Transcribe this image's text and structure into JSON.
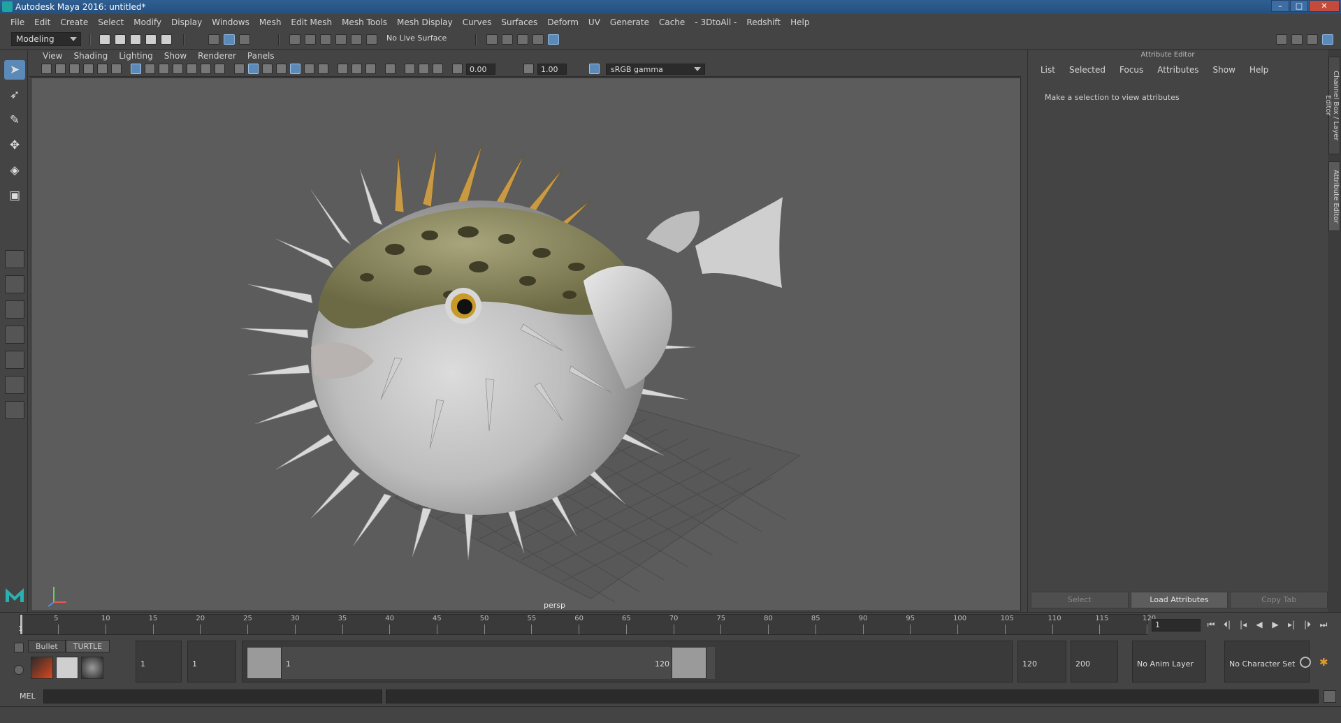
{
  "window": {
    "title": "Autodesk Maya 2016: untitled*",
    "buttons": [
      "–",
      "□",
      "✕"
    ]
  },
  "menubar": [
    "File",
    "Edit",
    "Create",
    "Select",
    "Modify",
    "Display",
    "Windows",
    "Mesh",
    "Edit Mesh",
    "Mesh Tools",
    "Mesh Display",
    "Curves",
    "Surfaces",
    "Deform",
    "UV",
    "Generate",
    "Cache",
    "- 3DtoAll -",
    "Redshift",
    "Help"
  ],
  "statusline": {
    "mode": "Modeling",
    "live_surface": "No Live Surface"
  },
  "viewport": {
    "menus": [
      "View",
      "Shading",
      "Lighting",
      "Show",
      "Renderer",
      "Panels"
    ],
    "exposure": "0.00",
    "gamma": "1.00",
    "color_space": "sRGB gamma",
    "camera": "persp"
  },
  "attribute_editor": {
    "title": "Attribute Editor",
    "menus": [
      "List",
      "Selected",
      "Focus",
      "Attributes",
      "Show",
      "Help"
    ],
    "message": "Make a selection to view attributes",
    "buttons": [
      "Select",
      "Load Attributes",
      "Copy Tab"
    ],
    "side_tabs": [
      "Channel Box / Layer Editor",
      "Attribute Editor"
    ]
  },
  "timeslider": {
    "ticks": [
      "5",
      "10",
      "15",
      "20",
      "25",
      "30",
      "35",
      "40",
      "45",
      "50",
      "55",
      "60",
      "65",
      "70",
      "75",
      "80",
      "85",
      "90",
      "95",
      "100",
      "105",
      "110",
      "115",
      "120"
    ],
    "current_frame_label": "1",
    "current_frame": "1",
    "playback_buttons": [
      "⏮",
      "⏴|",
      "|◂",
      "◀",
      "▶",
      "▸|",
      "|⏵",
      "⏭"
    ]
  },
  "range": {
    "shelf_tabs": [
      "Bullet",
      "TURTLE"
    ],
    "start_time": "1",
    "playback_start": "1",
    "range_start_label": "1",
    "range_end_label": "120",
    "playback_end": "120",
    "end_time": "200",
    "anim_layer": "No Anim Layer",
    "character_set": "No Character Set"
  },
  "cmdline": {
    "label": "MEL"
  }
}
